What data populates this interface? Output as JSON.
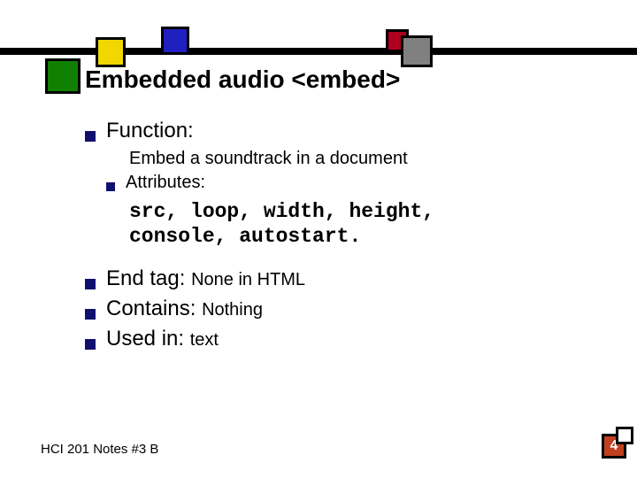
{
  "title": "Embedded audio <embed>",
  "bullets": {
    "function_label": "Function:",
    "function_detail": "Embed a soundtrack in a document",
    "attributes_label": "Attributes:",
    "attributes_code_line1": "src, loop, width, height,",
    "attributes_code_line2": "console, autostart.",
    "end_tag_label": "End tag: ",
    "end_tag_value": "None in HTML",
    "contains_label": "Contains: ",
    "contains_value": "Nothing",
    "used_in_label": "Used in: ",
    "used_in_value": "text"
  },
  "footer": "HCI 201 Notes #3 B",
  "page_number": "4"
}
